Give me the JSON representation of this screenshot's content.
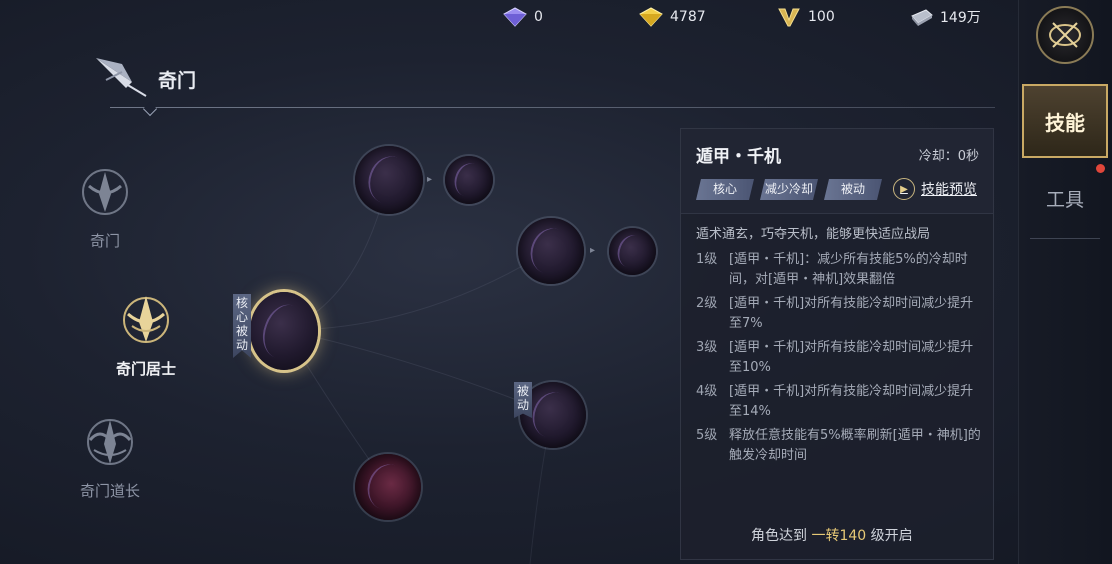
{
  "currency": {
    "diamond": "0",
    "gold": "4787",
    "v_points": "100",
    "silver": "149万"
  },
  "header": {
    "title": "奇门"
  },
  "classes": [
    {
      "label": "奇门"
    },
    {
      "label": "奇门居士"
    },
    {
      "label": "奇门道长"
    }
  ],
  "tree_tags": {
    "core_passive": "核心被动",
    "passive": "被动"
  },
  "panel": {
    "title": "遁甲・千机",
    "cooldown": "冷却：0秒",
    "chips": [
      "核心",
      "减少冷却",
      "被动"
    ],
    "preview_label": "技能预览",
    "description": "遁术通玄，巧夺天机，能够更快适应战局",
    "levels": [
      {
        "lv": "1级",
        "text": "[遁甲・千机]：减少所有技能5%的冷却时间，对[遁甲・神机]效果翻倍"
      },
      {
        "lv": "2级",
        "text": "[遁甲・千机]对所有技能冷却时间减少提升至7%"
      },
      {
        "lv": "3级",
        "text": "[遁甲・千机]对所有技能冷却时间减少提升至10%"
      },
      {
        "lv": "4级",
        "text": "[遁甲・千机]对所有技能冷却时间减少提升至14%"
      },
      {
        "lv": "5级",
        "text": "释放任意技能有5%概率刷新[遁甲・神机]的触发冷却时间"
      }
    ],
    "unlock_prefix": "角色达到",
    "unlock_highlight": "一转140",
    "unlock_suffix": "级开启"
  },
  "sidenav": {
    "skill_tab": "技能",
    "tool_tab": "工具"
  },
  "colors": {
    "accent_gold": "#c9a964",
    "highlight_text": "#e7c976",
    "notify_red": "#e0463a"
  }
}
